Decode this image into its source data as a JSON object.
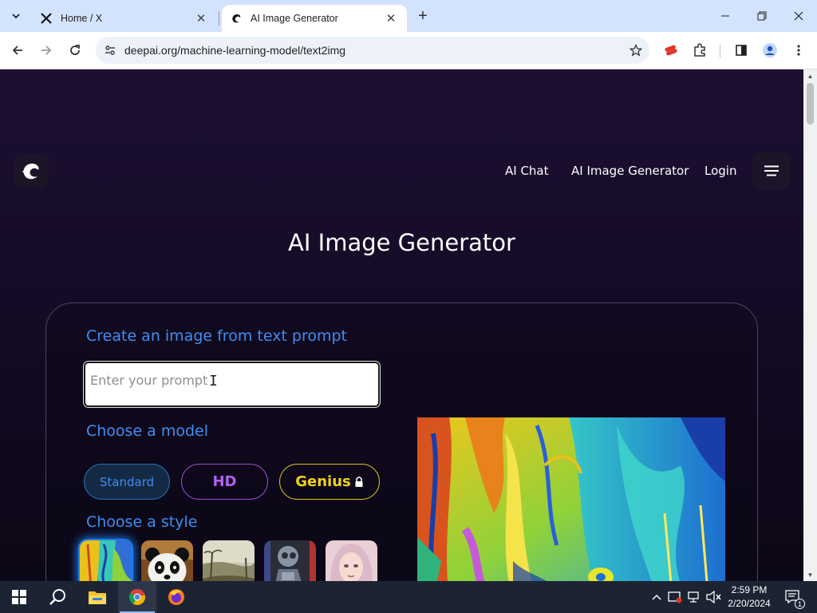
{
  "browser": {
    "tabs": [
      {
        "title": "Home / X",
        "favicon": "x-logo-icon"
      },
      {
        "title": "AI Image Generator",
        "favicon": "deepai-logo-icon"
      }
    ],
    "url": "deepai.org/machine-learning-model/text2img"
  },
  "nav": {
    "links": [
      "AI Chat",
      "AI Image Generator",
      "Login"
    ]
  },
  "main": {
    "title": "AI Image Generator",
    "prompt_heading": "Create an image from text prompt",
    "prompt_placeholder": "Enter your prompt",
    "model_heading": "Choose a model",
    "models": [
      "Standard",
      "HD",
      "Genius"
    ],
    "style_heading": "Choose a style"
  },
  "taskbar": {
    "time": "2:59 PM",
    "date": "2/20/2024",
    "notification_count": "1"
  },
  "colors": {
    "accent_blue": "#3d8ef0",
    "hd_purple": "#b360f0",
    "genius_yellow": "#f1d21a",
    "page_bg": "#150b26"
  }
}
